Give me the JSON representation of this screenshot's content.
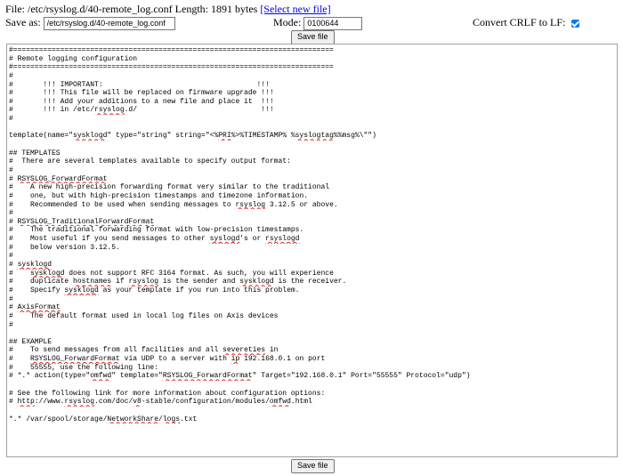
{
  "header": {
    "prefix": "File: ",
    "path": "/etc/rsyslog.d/40-remote_log.conf",
    "length_text": " Length: 1891 bytes ",
    "select_link": "[Select new file]"
  },
  "form": {
    "save_as_label": "Save as:",
    "save_as_value": "/etc/rsyslog.d/40-remote_log.conf",
    "mode_label": "Mode:",
    "mode_value": "0100644",
    "crlf_label": "Convert CRLF to LF:",
    "crlf_checked": true,
    "save_button_label": "Save file"
  },
  "editor": {
    "lines": [
      "#===========================================================================",
      "# Remote logging configuration",
      "#===========================================================================",
      "#",
      "#       !!! IMPORTANT:                                    !!!",
      "#       !!! This file will be replaced on firmware upgrade !!!",
      "#       !!! Add your additions to a new file and place it  !!!",
      "#       !!! in /etc/rsyslog.d/                             !!!",
      "#",
      "",
      "template(name=\"sysklogd\" type=\"string\" string=\"<%PRI%>%TIMESTAMP% %syslogtag%%msg%\\\"\")",
      "",
      "## TEMPLATES",
      "#  There are several templates available to specify output format:",
      "#",
      "# RSYSLOG_ForwardFormat",
      "#    A new high-precision forwarding format very similar to the traditional",
      "#    one, but with high-precision timestamps and timezone information.",
      "#    Recommended to be used when sending messages to rsyslog 3.12.5 or above.",
      "#",
      "# RSYSLOG_TraditionalForwardFormat",
      "#    The traditional forwarding format with low-precision timestamps.",
      "#    Most useful if you send messages to other syslogd's or rsyslogd",
      "#    below version 3.12.5.",
      "#",
      "# sysklogd",
      "#    sysklogd does not support RFC 3164 format. As such, you will experience",
      "#    duplicate hostnames if rsyslog is the sender and sysklogd is the receiver.",
      "#    Specify sysklogd as your template if you run into this problem.",
      "#",
      "# AxisFormat",
      "#    The default format used in local log files on Axis devices",
      "#",
      "",
      "## EXAMPLE",
      "#    To send messages from all facilities and all severeties in",
      "#    RSYSLOG_ForwardFormat via UDP to a server with ip 192.168.0.1 on port",
      "#    55555, use the following line:",
      "# *.* action(type=\"omfwd\" template=\"RSYSLOG_ForwardFormat\" Target=\"192.168.0.1\" Port=\"55555\" Protocol=\"udp\")",
      "",
      "# See the following link for more information about configuration options:",
      "# http://www.rsyslog.com/doc/v8-stable/configuration/modules/omfwd.html",
      "",
      "*.* /var/spool/storage/NetworkShare/logs.txt"
    ]
  }
}
